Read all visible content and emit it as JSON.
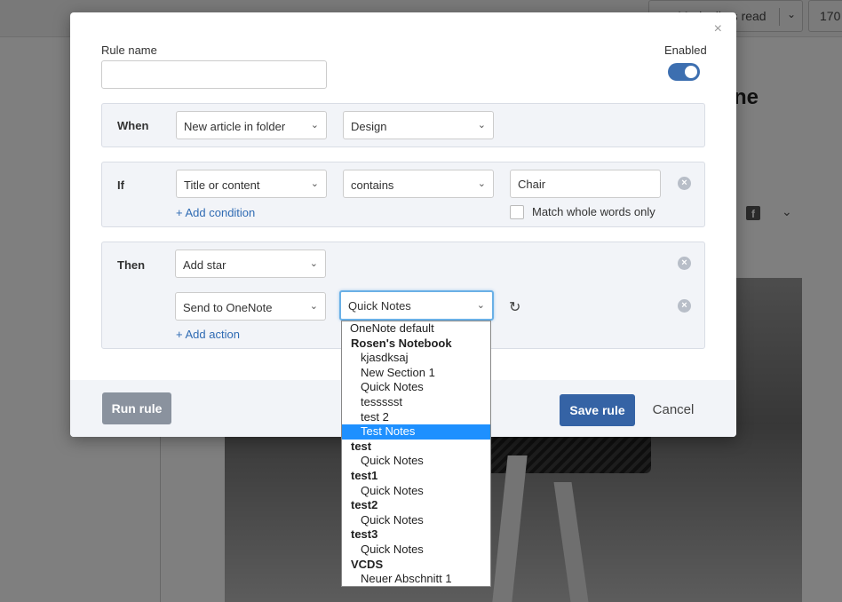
{
  "background": {
    "mark_read_label": "Mark all as read",
    "count_label": "170",
    "headline_fragment": "ne"
  },
  "modal": {
    "rule_name_label": "Rule name",
    "rule_name_value": "",
    "enabled_label": "Enabled",
    "enabled": true,
    "when": {
      "title": "When",
      "trigger": "New article in folder",
      "folder": "Design"
    },
    "if": {
      "title": "If",
      "field": "Title or content",
      "operator": "contains",
      "value": "Chair",
      "add_condition_label": "+ Add condition",
      "match_whole_words_label": "Match whole words only",
      "match_whole_words": false
    },
    "then": {
      "title": "Then",
      "action1": "Add star",
      "action2": "Send to OneNote",
      "action2_target": "Quick Notes",
      "add_action_label": "+ Add action"
    },
    "footer": {
      "run_rule_label": "Run rule",
      "save_rule_label": "Save rule",
      "cancel_label": "Cancel"
    }
  },
  "dropdown": {
    "items": [
      {
        "label": "OneNote default",
        "kind": "top"
      },
      {
        "label": "Rosen's Notebook",
        "kind": "group"
      },
      {
        "label": "kjasdksaj",
        "kind": "child"
      },
      {
        "label": "New Section 1",
        "kind": "child"
      },
      {
        "label": "Quick Notes",
        "kind": "child"
      },
      {
        "label": "tessssst",
        "kind": "child"
      },
      {
        "label": "test 2",
        "kind": "child"
      },
      {
        "label": "Test Notes",
        "kind": "child",
        "selected": true
      },
      {
        "label": "test",
        "kind": "group"
      },
      {
        "label": "Quick Notes",
        "kind": "child"
      },
      {
        "label": "test1",
        "kind": "group"
      },
      {
        "label": "Quick Notes",
        "kind": "child"
      },
      {
        "label": "test2",
        "kind": "group"
      },
      {
        "label": "Quick Notes",
        "kind": "child"
      },
      {
        "label": "test3",
        "kind": "group"
      },
      {
        "label": "Quick Notes",
        "kind": "child"
      },
      {
        "label": "VCDS",
        "kind": "group"
      },
      {
        "label": "Neuer Abschnitt 1",
        "kind": "child"
      }
    ]
  },
  "colors": {
    "accent": "#3563a5",
    "toggle_on": "#3d6fb0",
    "selected_item": "#1e90ff",
    "link": "#2f6bb3"
  }
}
